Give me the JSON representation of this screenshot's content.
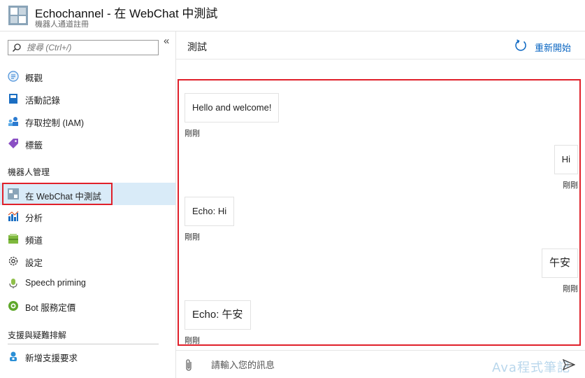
{
  "header": {
    "title": "Echochannel - 在 WebChat 中測試",
    "subtitle": "機器人通道註冊"
  },
  "sidebar": {
    "search_placeholder": "搜尋 (Ctrl+/)",
    "collapse_glyph": "«",
    "items": [
      {
        "label": "概觀",
        "icon": "overview-icon"
      },
      {
        "label": "活動記錄",
        "icon": "activity-log-icon"
      },
      {
        "label": "存取控制 (IAM)",
        "icon": "iam-icon"
      },
      {
        "label": "標籤",
        "icon": "tag-icon"
      }
    ],
    "section_bot": "機器人管理",
    "bot_items": [
      {
        "label": "在 WebChat 中測試",
        "icon": "webchat-icon",
        "active": true
      },
      {
        "label": "分析",
        "icon": "analytics-icon"
      },
      {
        "label": "頻道",
        "icon": "channels-icon"
      },
      {
        "label": "設定",
        "icon": "settings-icon"
      },
      {
        "label": "Speech priming",
        "icon": "speech-icon"
      },
      {
        "label": "Bot 服務定價",
        "icon": "pricing-icon"
      }
    ],
    "section_support": "支援與疑難排解",
    "support_items": [
      {
        "label": "新增支援要求",
        "icon": "support-icon"
      }
    ]
  },
  "main": {
    "title": "測試",
    "restart_label": "重新開始",
    "messages": [
      {
        "from": "bot",
        "text": "Hello and welcome!",
        "time": "剛剛"
      },
      {
        "from": "user",
        "text": "Hi",
        "time": "剛剛"
      },
      {
        "from": "bot",
        "text": "Echo: Hi",
        "time": "剛剛"
      },
      {
        "from": "user",
        "text": "午安",
        "time": "剛剛"
      },
      {
        "from": "bot",
        "text": "Echo: 午安",
        "time": "剛剛"
      }
    ],
    "composer_placeholder": "請輸入您的訊息",
    "watermark": "Ava程式筆記"
  },
  "colors": {
    "accent": "#0a66c2",
    "highlight_border": "#e0202a",
    "active_bg": "#d9ebf8"
  }
}
